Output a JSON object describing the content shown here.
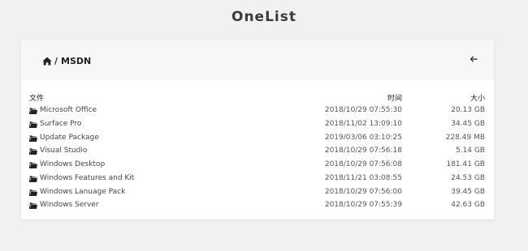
{
  "app": {
    "title": "OneList"
  },
  "breadcrumb": {
    "icon": "home-icon",
    "separator": "/",
    "current": "MSDN"
  },
  "toolbar": {
    "back_icon": "arrow-left-icon"
  },
  "table": {
    "headers": {
      "name": "文件",
      "time": "时间",
      "size": "大小"
    },
    "rows": [
      {
        "name": "Microsoft Office",
        "time": "2018/10/29 07:55:30",
        "size": "20.13 GB"
      },
      {
        "name": "Surface Pro",
        "time": "2018/11/02 13:09:10",
        "size": "34.45 GB"
      },
      {
        "name": "Update Package",
        "time": "2019/03/06 03:10:25",
        "size": "228.49 MB"
      },
      {
        "name": "Visual Studio",
        "time": "2018/10/29 07:56:18",
        "size": "5.14 GB"
      },
      {
        "name": "Windows Desktop",
        "time": "2018/10/29 07:56:08",
        "size": "181.41 GB"
      },
      {
        "name": "Windows Features and Kit",
        "time": "2018/11/21 03:08:55",
        "size": "24.53 GB"
      },
      {
        "name": "Windows Lanuage Pack",
        "time": "2018/10/29 07:56:00",
        "size": "39.45 GB"
      },
      {
        "name": "Windows Server",
        "time": "2018/10/29 07:55:39",
        "size": "42.63 GB"
      }
    ]
  }
}
